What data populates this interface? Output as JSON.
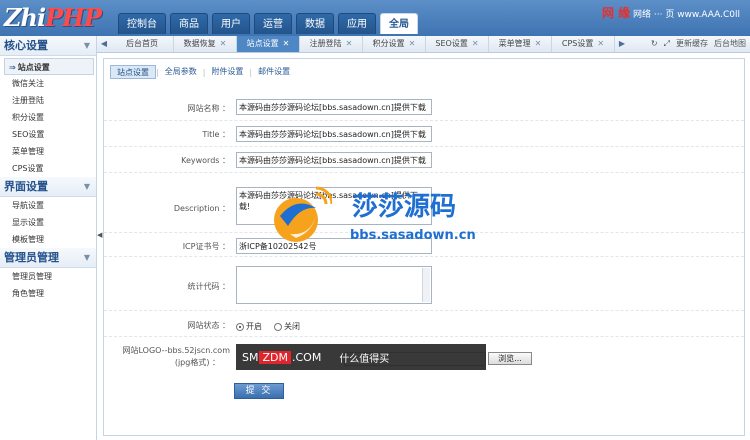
{
  "logo": {
    "zhi": "Zhi",
    "php": "PHP"
  },
  "main_nav": [
    "控制台",
    "商品",
    "用户",
    "运营",
    "数据",
    "应用",
    "全局"
  ],
  "top_right": {
    "brand": "网 缘",
    "text": "网络 ··· 页 www.AAA.C0ll"
  },
  "subtabs": [
    "后台首页",
    "数据恢复",
    "站点设置",
    "注册登陆",
    "积分设置",
    "SEO设置",
    "菜单管理",
    "CPS设置"
  ],
  "subtab_tools": {
    "refresh": "↻",
    "fullscreen": "⤢",
    "update_cache": "更新缓存",
    "sitemap": "后台地图"
  },
  "sidebar": {
    "groups": [
      {
        "title": "核心设置",
        "items": [
          "站点设置",
          "微信关注",
          "注册登陆",
          "积分设置",
          "SEO设置",
          "菜单管理",
          "CPS设置"
        ]
      },
      {
        "title": "界面设置",
        "items": [
          "导航设置",
          "显示设置",
          "模板管理"
        ]
      },
      {
        "title": "管理员管理",
        "items": [
          "管理员管理",
          "角色管理"
        ]
      }
    ]
  },
  "inner_tabs": [
    "站点设置",
    "全局参数",
    "附件设置",
    "邮件设置"
  ],
  "form": {
    "site_name": {
      "label": "网站名称 ：",
      "value": "本源码由莎莎源码论坛[bbs.sasadown.cn]提供下载"
    },
    "title": {
      "label": "Title ：",
      "value": "本源码由莎莎源码论坛[bbs.sasadown.cn]提供下载"
    },
    "keywords": {
      "label": "Keywords ：",
      "value": "本源码由莎莎源码论坛[bbs.sasadown.cn]提供下载"
    },
    "description": {
      "label": "Description ：",
      "value": "本源码由莎莎源码论坛[bbs.sasadown.cn]提供下载!"
    },
    "icp": {
      "label": "ICP证书号 ：",
      "value": "浙ICP备10202542号"
    },
    "stats_code": {
      "label": "统计代码 ：",
      "value": ""
    },
    "site_status": {
      "label": "网站状态 ：",
      "open": "开启",
      "close": "关闭"
    },
    "logo_upload": {
      "label_1": "网站LOGO--bbs.52jscn.com",
      "label_2": "(jpg格式) ：",
      "browse": "浏览..."
    },
    "submit": "提 交"
  },
  "watermark": {
    "brand": "莎莎源码",
    "url": "bbs.sasadown.cn",
    "sm_1": "SM",
    "sm_2": "ZDM",
    "sm_3": ".COM",
    "slogan": "什么值得买"
  }
}
